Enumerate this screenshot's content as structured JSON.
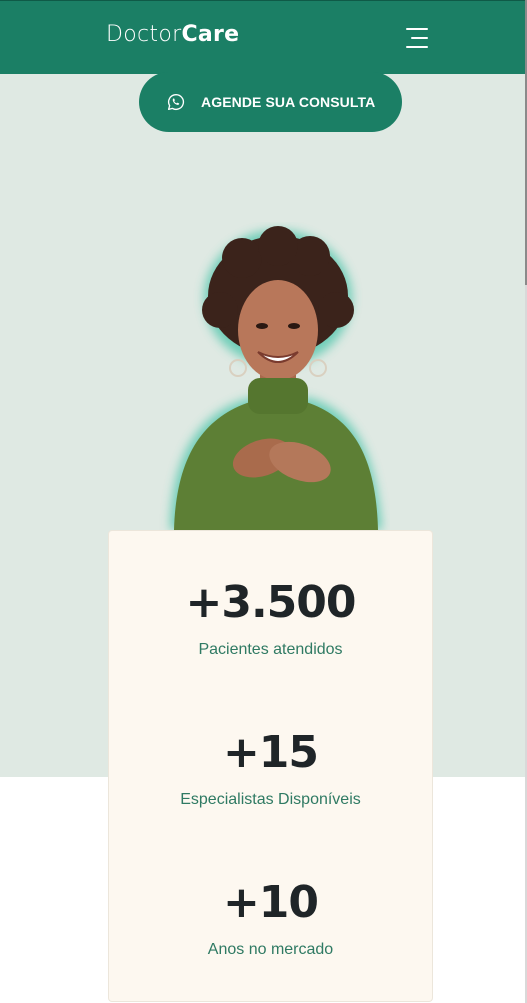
{
  "header": {
    "logo_light": "Doctor",
    "logo_bold": "Care"
  },
  "cta": {
    "label": "AGENDE SUA CONSULTA"
  },
  "stats": [
    {
      "value": "+3.500",
      "label": "Pacientes atendidos"
    },
    {
      "value": "+15",
      "label": "Especialistas Disponíveis"
    },
    {
      "value": "+10",
      "label": "Anos no mercado"
    }
  ],
  "colors": {
    "brand": "#1b7f65",
    "hero_background": "#dfe9e3",
    "card_background": "#fdf8f0",
    "number": "#1f2528",
    "caption": "#2f7a63"
  },
  "icons": {
    "menu": "hamburger-menu-icon",
    "cta": "whatsapp-icon"
  }
}
